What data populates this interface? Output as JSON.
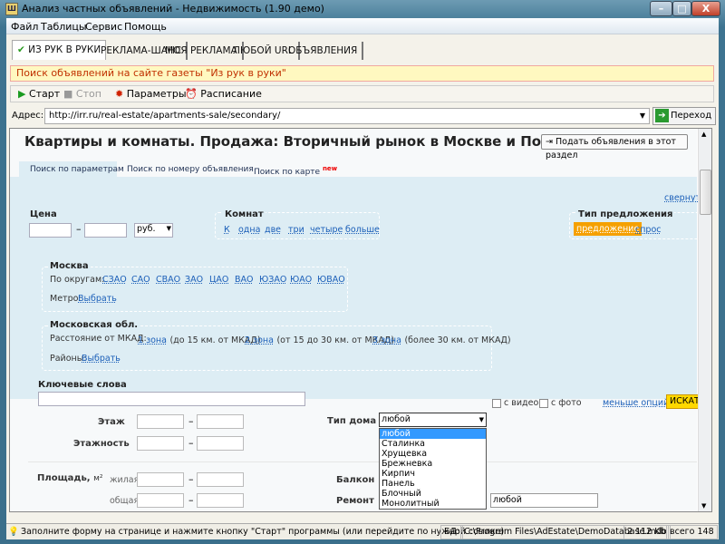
{
  "window": {
    "title": "Анализ частных объявлений - Недвижимость (1.90 демо)",
    "minimize": "–",
    "maximize": "□",
    "close": "X"
  },
  "menu": [
    "Файл",
    "Таблицы",
    "Сервис",
    "Помощь"
  ],
  "tabs": [
    {
      "label": "ИЗ РУК В РУКИ",
      "active": true
    },
    {
      "label": "РЕКЛАМА-ШАНС"
    },
    {
      "label": "МОЯ РЕКЛАМА"
    },
    {
      "label": "ЛЮБОЙ URL"
    },
    {
      "label": "ОБЪЯВЛЕНИЯ"
    }
  ],
  "banner": "Поиск объявлений на сайте газеты \"Из рук в руки\"",
  "toolbar": {
    "start": "Старт",
    "stop": "Стоп",
    "params": "Параметры",
    "schedule": "Расписание"
  },
  "address": {
    "label": "Адрес:",
    "value": "http://irr.ru/real-estate/apartments-sale/secondary/",
    "go": "Переход"
  },
  "page": {
    "title": "Квартиры и комнаты. Продажа: Вторичный рынок в Москве и Подмосковье",
    "post_button": "Подать объявления в этот раздел",
    "search_tabs": [
      "Поиск по параметрам",
      "Поиск по номеру объявления",
      "Поиск по карте"
    ],
    "new_badge": "new",
    "collapse": "свернуть",
    "price": {
      "label": "Цена",
      "dash": "–",
      "currency": "руб."
    },
    "rooms": {
      "label": "Комнат",
      "options": [
        "К",
        "одна",
        "две",
        "три",
        "четыре",
        "больше"
      ]
    },
    "offer_type": {
      "label": "Тип предложения",
      "options": [
        "предложение",
        "спрос"
      ],
      "selected": "предложение"
    },
    "moscow": {
      "label": "Москва",
      "districts_label": "По округам:",
      "districts": [
        "СЗАО",
        "САО",
        "СВАО",
        "ЗАО",
        "ЦАО",
        "ВАО",
        "ЮЗАО",
        "ЮАО",
        "ЮВАО"
      ],
      "metro_label": "Метро:",
      "metro_link": "Выбрать"
    },
    "region": {
      "label": "Московская обл.",
      "distance_label": "Расстояние от МКАД:",
      "zones": [
        {
          "link": "1 зона",
          "note": "(до 15 км. от МКАД)"
        },
        {
          "link": "2 зона",
          "note": "(от 15 до 30 км. от МКАД)"
        },
        {
          "link": "3 зона",
          "note": "(более 30 км. от МКАД)"
        }
      ],
      "areas_label": "Районы:",
      "areas_link": "Выбрать"
    },
    "keywords": {
      "label": "Ключевые слова"
    },
    "with_video": "с видео",
    "with_photo": "с фото",
    "fewer_options": "меньше опций",
    "search": "ИСКАТЬ →",
    "floor": "Этаж",
    "floors": "Этажность",
    "area": "Площадь,",
    "area_unit": "м²",
    "living": "жилая",
    "total": "общая",
    "dash": "–",
    "house_type": {
      "label": "Тип дома",
      "value": "любой",
      "options": [
        "любой",
        "Сталинка",
        "Хрущевка",
        "Брежневка",
        "Кирпич",
        "Панель",
        "Блочный",
        "Монолитный"
      ]
    },
    "balcony": "Балкон",
    "repair": {
      "label": "Ремонт",
      "value": "любой"
    }
  },
  "status": {
    "hint": "Заполните форму на странице и нажмите кнопку \"Старт\" программы (или перейдите по нужной ссылке)",
    "db_label": "БД:",
    "db_path": "C:\\Program Files\\AdEstate\\DemoDatabase.mdb",
    "size": "2 112 Kb",
    "total": "всего 148"
  },
  "colors": {
    "accent_orange": "#f5a000",
    "link": "#1a5eb8",
    "banner_bg": "#fff8c0",
    "panel_bg": "#ddedf4",
    "search_btn": "#ffd800"
  }
}
